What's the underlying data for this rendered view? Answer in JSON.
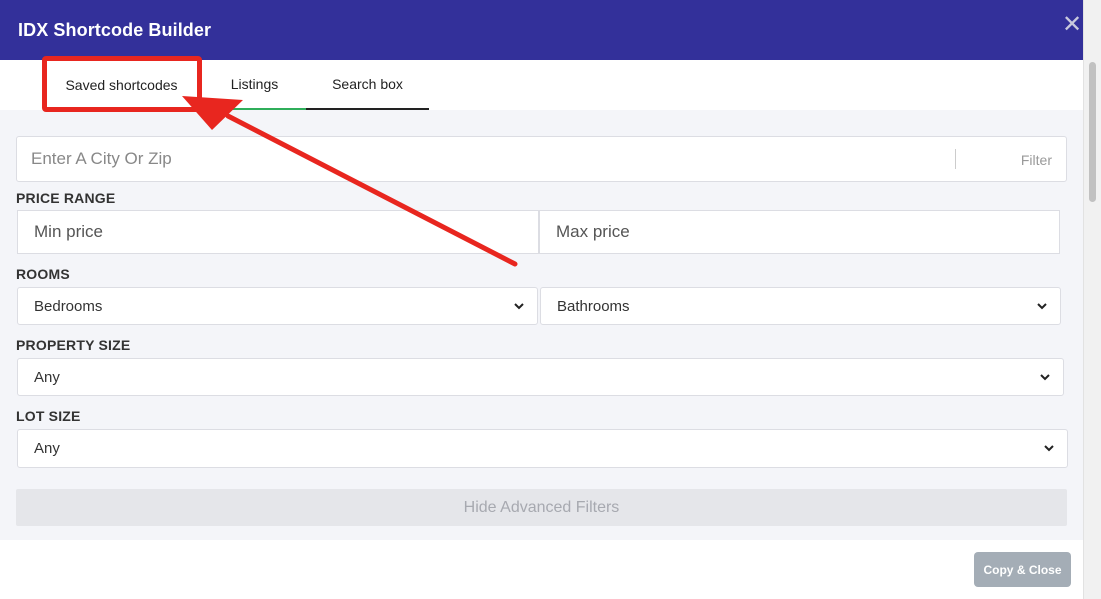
{
  "header": {
    "title": "IDX Shortcode Builder",
    "close_symbol": "✕"
  },
  "tabs": [
    {
      "label": "Saved shortcodes"
    },
    {
      "label": "Listings"
    },
    {
      "label": "Search box"
    }
  ],
  "search": {
    "placeholder": "Enter A City Or Zip",
    "filter_label": "Filter"
  },
  "price_range": {
    "label": "PRICE RANGE",
    "min_placeholder": "Min price",
    "max_placeholder": "Max price"
  },
  "rooms": {
    "label": "ROOMS",
    "bedrooms": "Bedrooms",
    "bathrooms": "Bathrooms"
  },
  "property_size": {
    "label": "PROPERTY SIZE",
    "value": "Any"
  },
  "lot_size": {
    "label": "LOT SIZE",
    "value": "Any"
  },
  "advanced": {
    "toggle_label": "Hide Advanced Filters"
  },
  "footer": {
    "copy_close_label": "Copy & Close"
  },
  "colors": {
    "header_bg": "#33309a",
    "highlight": "#e8261f",
    "listings_underline": "#2fae5a",
    "button_disabled": "#a4adb6"
  }
}
